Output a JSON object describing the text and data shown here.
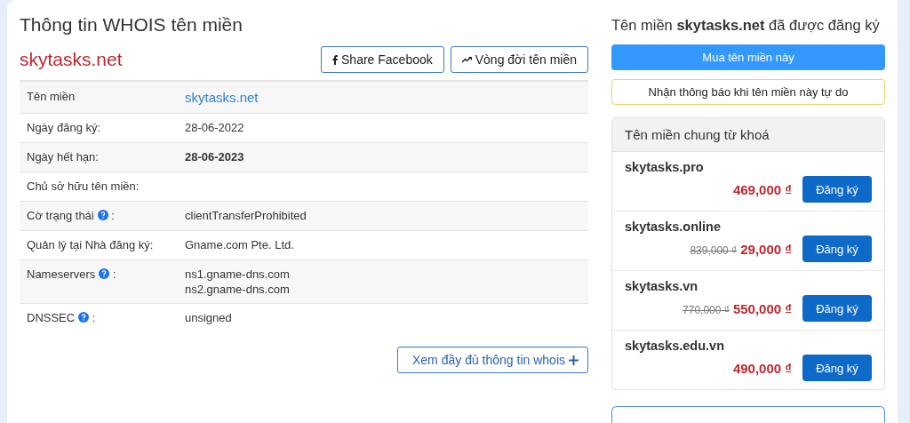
{
  "whois": {
    "title": "Thông tin WHOIS tên miền",
    "domain": "skytasks.net",
    "actions": [
      {
        "kind": "facebook",
        "label": "Share Facebook"
      },
      {
        "kind": "trend",
        "label": "Vòng đời tên miền"
      }
    ],
    "rows": [
      {
        "label": "Tên miền",
        "help": false,
        "kind": "link",
        "values": [
          "skytasks.net"
        ]
      },
      {
        "label": "Ngày đăng ký:",
        "help": false,
        "kind": "plain",
        "values": [
          "28-06-2022"
        ]
      },
      {
        "label": "Ngày hết hạn:",
        "help": false,
        "kind": "bold",
        "values": [
          "28-06-2023"
        ]
      },
      {
        "label": "Chủ sở hữu tên miền:",
        "help": false,
        "values": []
      },
      {
        "label": "Cờ trạng thái",
        "help": true,
        "help_suffix": ":",
        "kind": "plain",
        "values": [
          "clientTransferProhibited"
        ]
      },
      {
        "label": "Quản lý tại Nhà đăng ký:",
        "help": false,
        "kind": "plain",
        "values": [
          "Gname.com Pte. Ltd."
        ]
      },
      {
        "label": "Nameservers",
        "help": true,
        "help_suffix": ":",
        "kind": "plain",
        "values": [
          "ns1.gname-dns.com",
          "ns2.gname-dns.com"
        ]
      },
      {
        "label": "DNSSEC",
        "help": true,
        "help_suffix": ":",
        "kind": "plain",
        "values": [
          "unsigned"
        ]
      }
    ],
    "more_button": "Xem đầy đủ thông tin whois"
  },
  "aside": {
    "heading": "Tên miền **skytasks.net** đã được đăng ký",
    "buy_button": "Mua tên miền này",
    "notify_button": "Nhận thông báo khi tên miền này tự do",
    "suggestions": {
      "title": "Tên miền chung từ khoá",
      "items": [
        {
          "name": "skytasks.pro",
          "price": "469,000 ₫",
          "button": "Đăng ký"
        },
        {
          "name": "skytasks.online",
          "old_price": "839,000 ₫",
          "price": "29,000 ₫",
          "button": "Đăng ký"
        },
        {
          "name": "skytasks.vn",
          "old_price": "770,000 ₫",
          "price": "550,000 ₫",
          "button": "Đăng ký"
        },
        {
          "name": "skytasks.edu.vn",
          "price": "490,000 ₫",
          "button": "Đăng ký"
        }
      ]
    }
  }
}
